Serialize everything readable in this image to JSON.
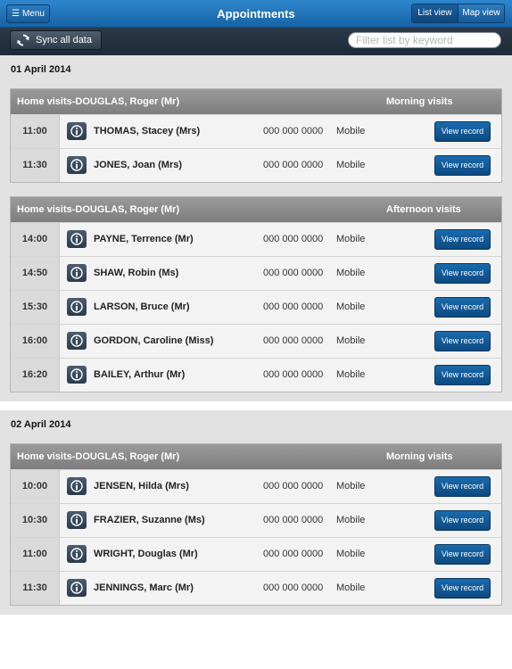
{
  "header": {
    "menu_label": "Menu",
    "title": "Appointments",
    "list_view_label": "List view",
    "map_view_label": "Map view"
  },
  "toolbar": {
    "sync_label": "Sync all data",
    "filter_placeholder": "Filter list by keyword"
  },
  "days": [
    {
      "date": "01 April 2014",
      "groups": [
        {
          "title": "Home visits-DOUGLAS, Roger (Mr)",
          "period": "Morning visits",
          "rows": [
            {
              "time": "11:00",
              "name": "THOMAS, Stacey (Mrs)",
              "phone": "000 000 0000",
              "phone_type": "Mobile",
              "button": "View record"
            },
            {
              "time": "11:30",
              "name": "JONES, Joan (Mrs)",
              "phone": "000 000 0000",
              "phone_type": "Mobile",
              "button": "View record"
            }
          ]
        },
        {
          "title": "Home visits-DOUGLAS, Roger (Mr)",
          "period": "Afternoon visits",
          "rows": [
            {
              "time": "14:00",
              "name": "PAYNE, Terrence (Mr)",
              "phone": "000 000 0000",
              "phone_type": "Mobile",
              "button": "View record"
            },
            {
              "time": "14:50",
              "name": "SHAW, Robin (Ms)",
              "phone": "000 000 0000",
              "phone_type": "Mobile",
              "button": "View record"
            },
            {
              "time": "15:30",
              "name": "LARSON, Bruce (Mr)",
              "phone": "000 000 0000",
              "phone_type": "Mobile",
              "button": "View record"
            },
            {
              "time": "16:00",
              "name": "GORDON, Caroline (Miss)",
              "phone": "000 000 0000",
              "phone_type": "Mobile",
              "button": "View record"
            },
            {
              "time": "16:20",
              "name": "BAILEY, Arthur (Mr)",
              "phone": "000 000 0000",
              "phone_type": "Mobile",
              "button": "View record"
            }
          ]
        }
      ]
    },
    {
      "date": "02 April 2014",
      "groups": [
        {
          "title": "Home visits-DOUGLAS, Roger (Mr)",
          "period": "Morning visits",
          "rows": [
            {
              "time": "10:00",
              "name": "JENSEN, Hilda (Mrs)",
              "phone": "000 000 0000",
              "phone_type": "Mobile",
              "button": "View record"
            },
            {
              "time": "10:30",
              "name": "FRAZIER, Suzanne (Ms)",
              "phone": "000 000 0000",
              "phone_type": "Mobile",
              "button": "View record"
            },
            {
              "time": "11:00",
              "name": "WRIGHT, Douglas (Mr)",
              "phone": "000 000 0000",
              "phone_type": "Mobile",
              "button": "View record"
            },
            {
              "time": "11:30",
              "name": "JENNINGS, Marc (Mr)",
              "phone": "000 000 0000",
              "phone_type": "Mobile",
              "button": "View record"
            }
          ]
        }
      ]
    }
  ],
  "icons": {
    "menu": "hamburger-icon",
    "sync": "sync-icon",
    "info": "info-icon"
  },
  "colors": {
    "header_blue": "#1f74bb",
    "toolbar_dark": "#25323f",
    "button_blue": "#1460a0",
    "group_header_gray": "#8c8c8c"
  }
}
